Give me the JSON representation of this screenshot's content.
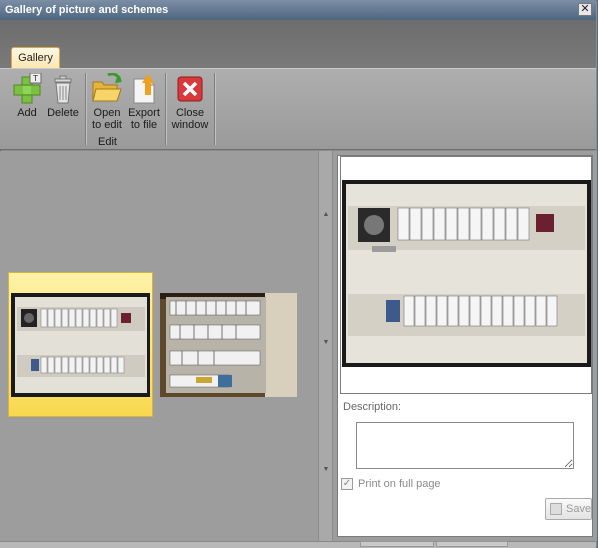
{
  "window": {
    "title": "Gallery of picture and schemes",
    "close_glyph": "✕"
  },
  "ribbon": {
    "tab_label": "Gallery",
    "buttons": [
      {
        "id": "add",
        "line1": "Add",
        "line2": "",
        "icon": "add-icon"
      },
      {
        "id": "delete",
        "line1": "Delete",
        "line2": "",
        "icon": "trash-icon"
      },
      {
        "id": "open",
        "line1": "Open",
        "line2": "to edit",
        "icon": "folder-open-icon"
      },
      {
        "id": "export",
        "line1": "Export",
        "line2": "to file",
        "icon": "export-icon"
      },
      {
        "id": "close",
        "line1": "Close",
        "line2": "window",
        "icon": "close-window-icon"
      }
    ],
    "group_label": "Edit"
  },
  "gallery": {
    "thumbnails": [
      {
        "name": "electrical-panel-photo-1",
        "selected": true
      },
      {
        "name": "electrical-panel-photo-2",
        "selected": false
      }
    ]
  },
  "details": {
    "description_label": "Description:",
    "description_value": "",
    "print_label": "Print on full page",
    "print_checked": true,
    "save_label": "Save"
  },
  "colors": {
    "selection": "#f9d84f",
    "titlebar": "#4f6680",
    "close_button": "#d9393a",
    "add_icon": "#7bc043"
  }
}
